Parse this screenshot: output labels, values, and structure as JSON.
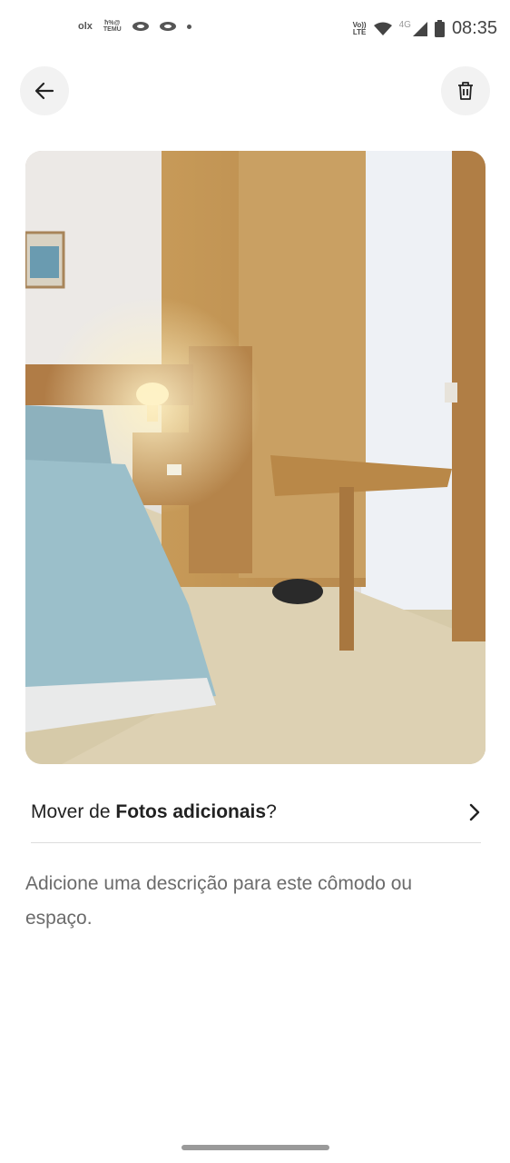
{
  "status_bar": {
    "app_olx": "olx",
    "app_temu_line1": "ħ%@",
    "app_temu_line2": "TEMU",
    "volte_line1": "Vo))",
    "volte_line2": "LTE",
    "network": "4G",
    "time": "08:35"
  },
  "header": {
    "back_icon": "arrow-left-icon",
    "delete_icon": "trash-icon"
  },
  "photo": {
    "alt": "Quarto com cama, criado-mudo com abajur, armário de madeira e mesa"
  },
  "move": {
    "prefix": "Mover de ",
    "album": "Fotos adicionais",
    "suffix": "?"
  },
  "description_placeholder": "Adicione uma descrição para este cômodo ou espaço."
}
